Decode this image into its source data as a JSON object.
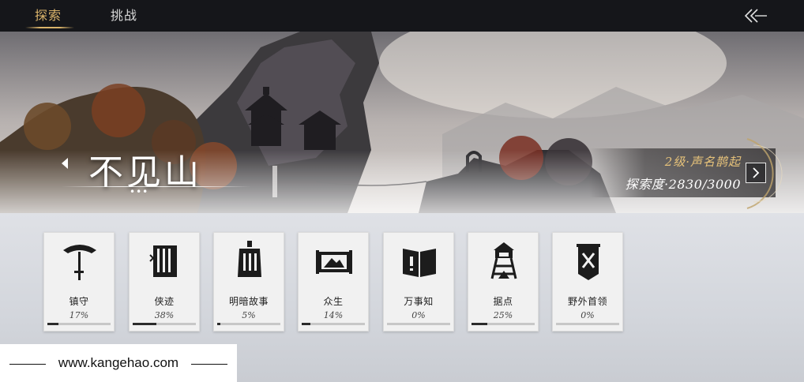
{
  "top_tabs": [
    {
      "label": "探索",
      "active": true
    },
    {
      "label": "挑战",
      "active": false
    }
  ],
  "banner": {
    "map_name": "不见山",
    "page_dots": "•••",
    "level": "2级·声名鹊起",
    "exploration": "探索度·2830/3000"
  },
  "cards": [
    {
      "label": "镇守",
      "percent": "17%",
      "progress": 0.17,
      "icon": "umbrella-icon"
    },
    {
      "label": "侠迹",
      "percent": "38%",
      "progress": 0.38,
      "icon": "scroll-book-icon"
    },
    {
      "label": "明暗故事",
      "percent": "5%",
      "progress": 0.05,
      "icon": "bell-icon"
    },
    {
      "label": "众生",
      "percent": "14%",
      "progress": 0.14,
      "icon": "landscape-scroll-icon"
    },
    {
      "label": "万事知",
      "percent": "0%",
      "progress": 0.0,
      "icon": "open-book-icon"
    },
    {
      "label": "据点",
      "percent": "25%",
      "progress": 0.25,
      "icon": "watchtower-icon"
    },
    {
      "label": "野外首领",
      "percent": "0%",
      "progress": 0.0,
      "icon": "crossed-banner-icon"
    }
  ],
  "watermark": {
    "site": "www.kangehao.com"
  },
  "colors": {
    "accent_gold": "#d9b36a",
    "top_bar": "#15161a",
    "progress_fill": "#2c2c2c"
  }
}
